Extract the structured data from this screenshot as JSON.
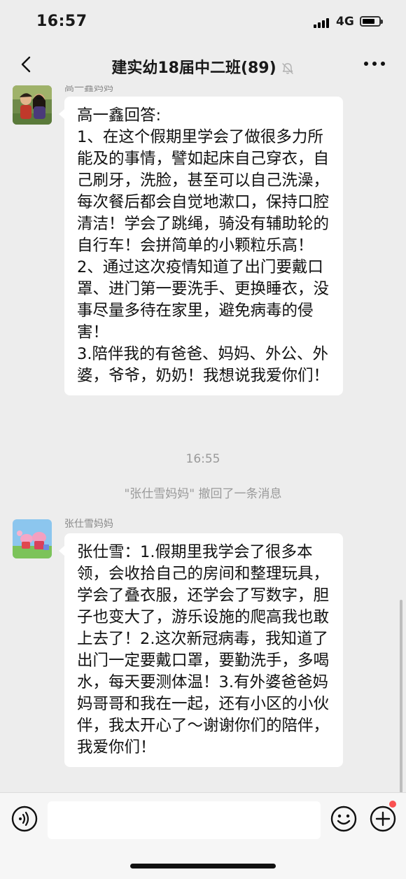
{
  "status": {
    "time": "16:57",
    "network": "4G",
    "battery_level": 0.75
  },
  "header": {
    "title": "建实幼18届中二班(89)"
  },
  "messages": [
    {
      "sender": "高一鑫妈妈",
      "text": "高一鑫回答:\n1、在这个假期里学会了做很多力所能及的事情，譬如起床自己穿衣，自己刷牙，洗脸，甚至可以自己洗澡，每次餐后都会自觉地漱口，保持口腔清洁！学会了跳绳，骑没有辅助轮的自行车！会拼简单的小颗粒乐高！\n2、通过这次疫情知道了出门要戴口罩、进门第一要洗手、更换睡衣，没事尽量多待在家里，避免病毒的侵害！\n3.陪伴我的有爸爸、妈妈、外公、外婆，爷爷，奶奶！我想说我爱你们！"
    },
    {
      "sender": "张仕雪妈妈",
      "text": "张仕雪：1.假期里我学会了很多本领，会收拾自己的房间和整理玩具，学会了叠衣服，还学会了写数字，胆子也变大了，游乐设施的爬高我也敢上去了！2.这次新冠病毒，我知道了出门一定要戴口罩，要勤洗手，多喝水，每天要测体温！3.有外婆爸爸妈妈哥哥和我在一起，还有小区的小伙伴，我太开心了～谢谢你们的陪伴，我爱你们！"
    }
  ],
  "timestamp": "16:55",
  "recall_notice": "\"张仕雪妈妈\" 撤回了一条消息",
  "input": {
    "value": "",
    "placeholder": ""
  },
  "icons": {
    "back": "chevron-left-icon",
    "mute": "bell-off-icon",
    "more": "more-dots-icon",
    "voice": "voice-icon",
    "emoji": "emoji-icon",
    "plus": "plus-icon"
  },
  "colors": {
    "background": "#ededed",
    "bubble": "#ffffff",
    "badge": "#fa5151"
  }
}
